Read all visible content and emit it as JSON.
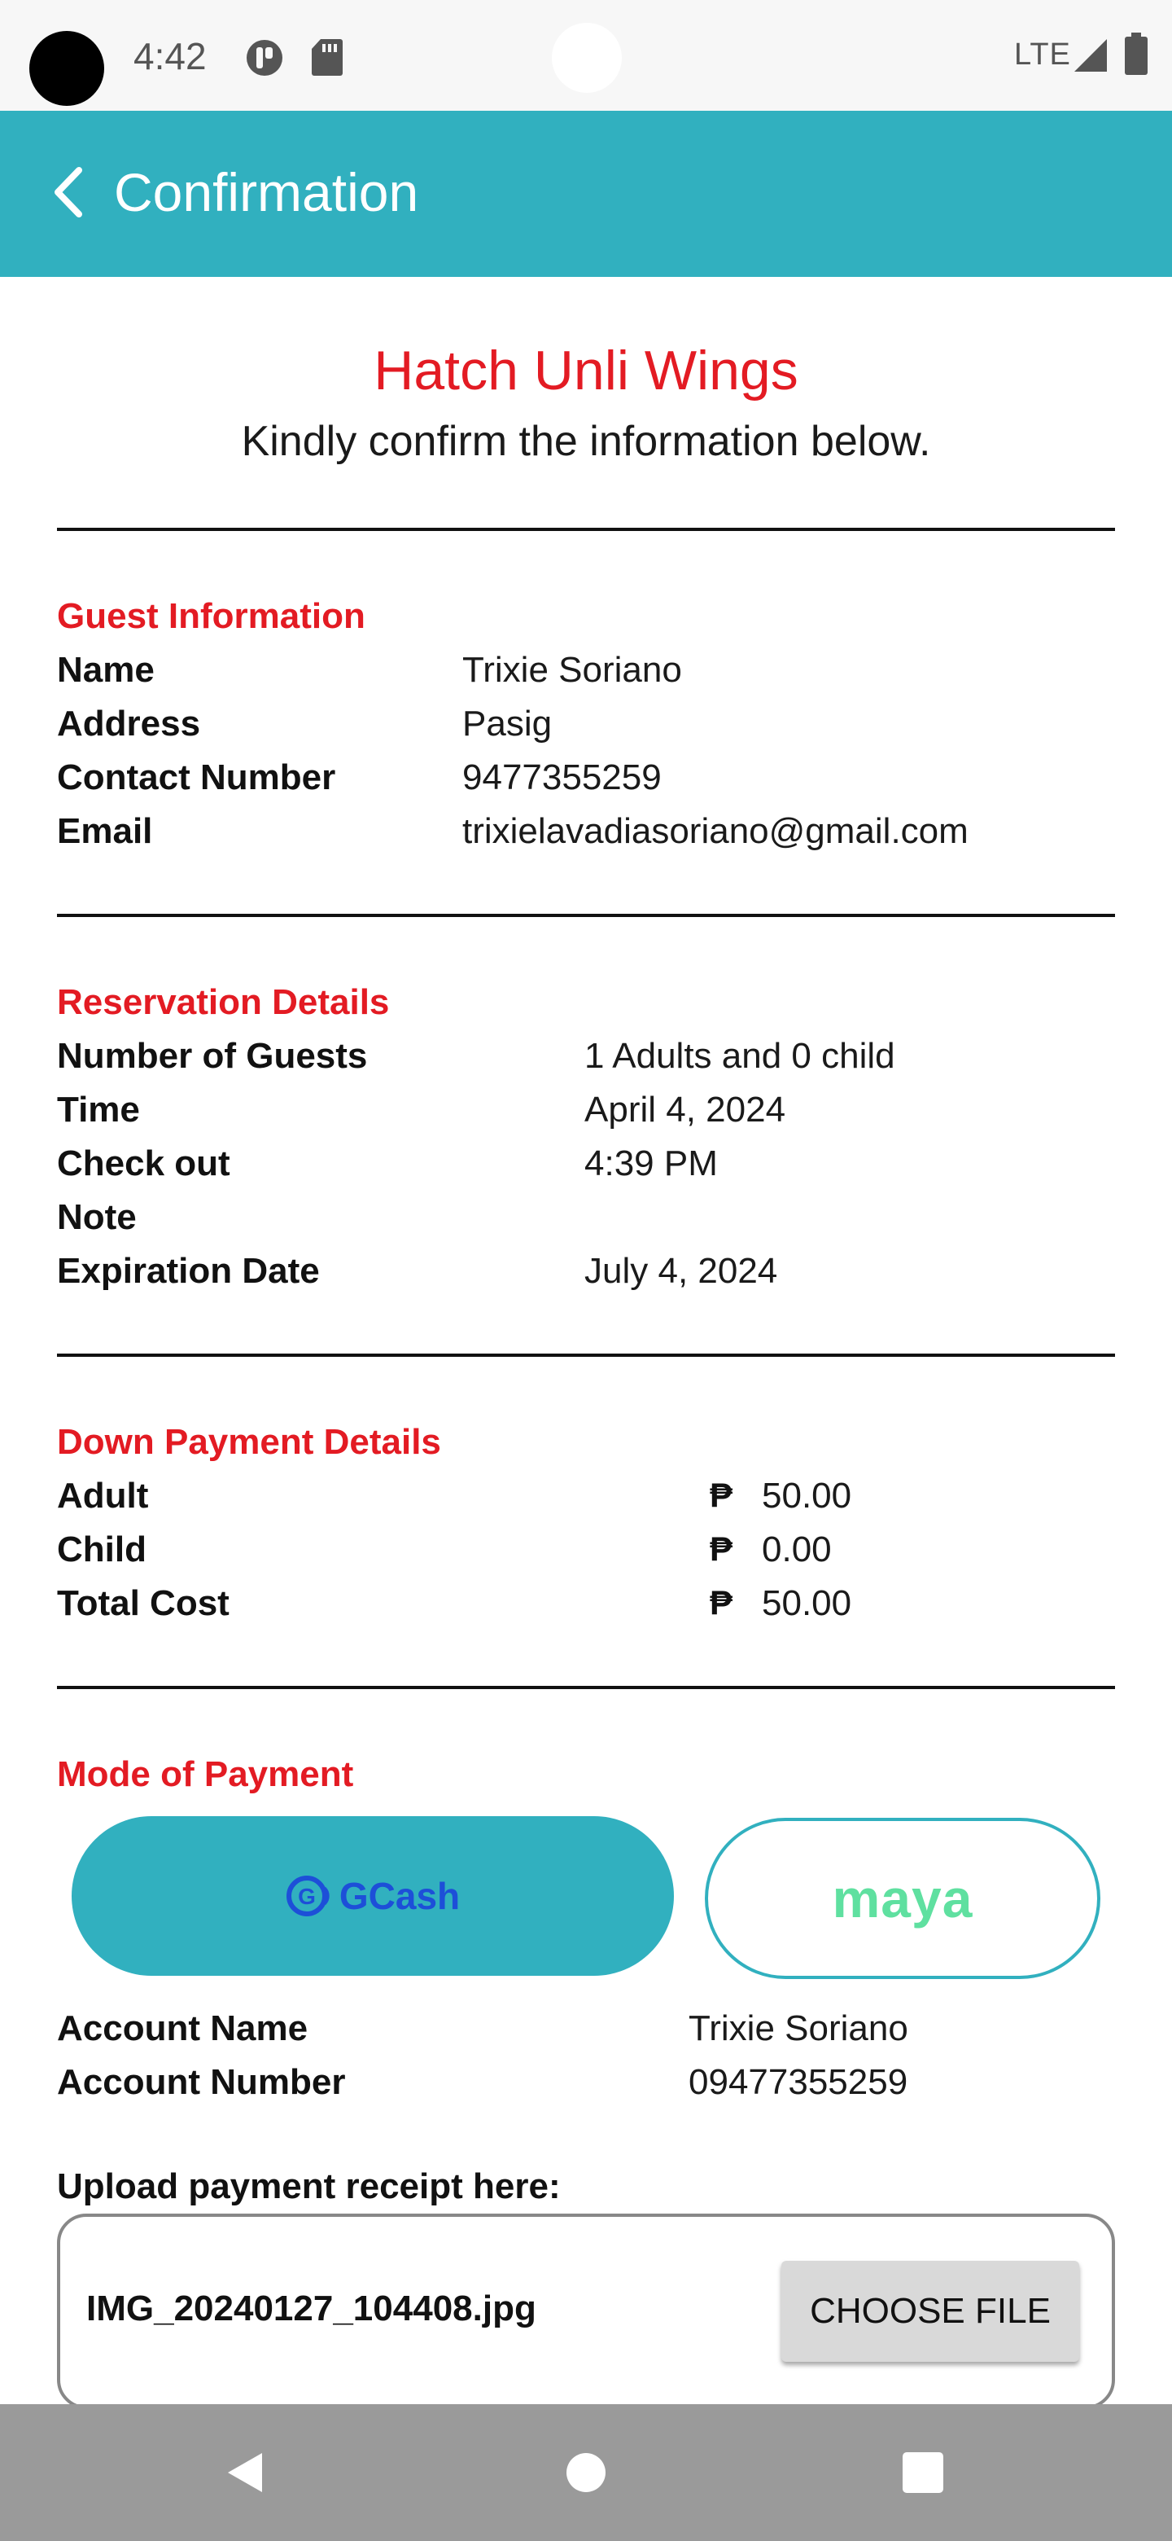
{
  "status_bar": {
    "time": "4:42",
    "network": "LTE",
    "icons": [
      "pocket-icon",
      "sd-card-icon",
      "signal-icon",
      "battery-icon"
    ]
  },
  "app_bar": {
    "title": "Confirmation",
    "back_icon": "chevron-left-icon",
    "color": "#31b0bf"
  },
  "header": {
    "title": "Hatch Unli Wings",
    "subtitle": "Kindly confirm the information below.",
    "title_color": "#e31b23"
  },
  "guest_info": {
    "title": "Guest Information",
    "rows": [
      {
        "label": "Name",
        "value": "Trixie Soriano"
      },
      {
        "label": "Address",
        "value": "Pasig"
      },
      {
        "label": "Contact Number",
        "value": "9477355259"
      },
      {
        "label": "Email",
        "value": "trixielavadiasoriano@gmail.com"
      }
    ]
  },
  "reservation": {
    "title": "Reservation Details",
    "rows": [
      {
        "label": "Number of Guests",
        "value": "1 Adults and 0 child"
      },
      {
        "label": "Time",
        "value": "April 4, 2024"
      },
      {
        "label": "Check out",
        "value": "4:39 PM"
      },
      {
        "label": "Note",
        "value": ""
      },
      {
        "label": "Expiration Date",
        "value": "July 4, 2024"
      }
    ]
  },
  "down_payment": {
    "title": "Down Payment Details",
    "currency": "₱",
    "rows": [
      {
        "label": "Adult",
        "value": "50.00"
      },
      {
        "label": "Child",
        "value": "0.00"
      },
      {
        "label": "Total Cost",
        "value": "50.00"
      }
    ]
  },
  "payment": {
    "title": "Mode of Payment",
    "options": [
      {
        "label": "GCash",
        "selected": true
      },
      {
        "label": "maya",
        "selected": false
      }
    ],
    "rows": [
      {
        "label": "Account Name",
        "value": "Trixie Soriano"
      },
      {
        "label": "Account Number",
        "value": "09477355259"
      }
    ]
  },
  "upload": {
    "label": "Upload payment receipt here:",
    "file_name": "IMG_20240127_104408.jpg",
    "button_label": "CHOOSE FILE"
  },
  "nav_bar": {
    "icons": [
      "back-triangle-icon",
      "home-circle-icon",
      "recents-square-icon"
    ]
  }
}
